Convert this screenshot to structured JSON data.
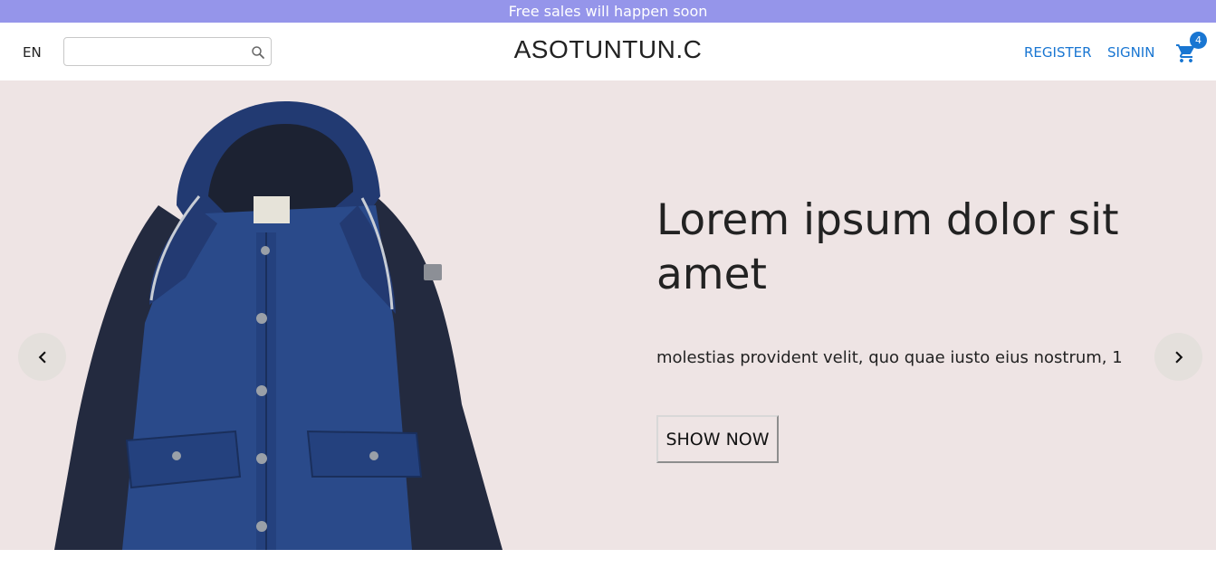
{
  "announcement": {
    "text": "Free sales will happen soon"
  },
  "navbar": {
    "language": "EN",
    "search": {
      "value": "",
      "placeholder": ""
    },
    "logo": "ASOTUNTUN.C",
    "links": {
      "register": "REGISTER",
      "signin": "SIGNIN"
    },
    "cart": {
      "count": "4"
    }
  },
  "slider": {
    "title": "Lorem ipsum dolor sit amet",
    "description": "molestias provident velit, quo quae iusto eius nostrum, 1",
    "button_label": "SHOW NOW",
    "image": "navy-blue-hooded-jacket",
    "icons": {
      "prev": "chevron-left-icon",
      "next": "chevron-right-icon"
    }
  },
  "colors": {
    "announcement_bg": "#9595ea",
    "accent": "#1976d2",
    "slider_bg": "#eee4e4"
  }
}
